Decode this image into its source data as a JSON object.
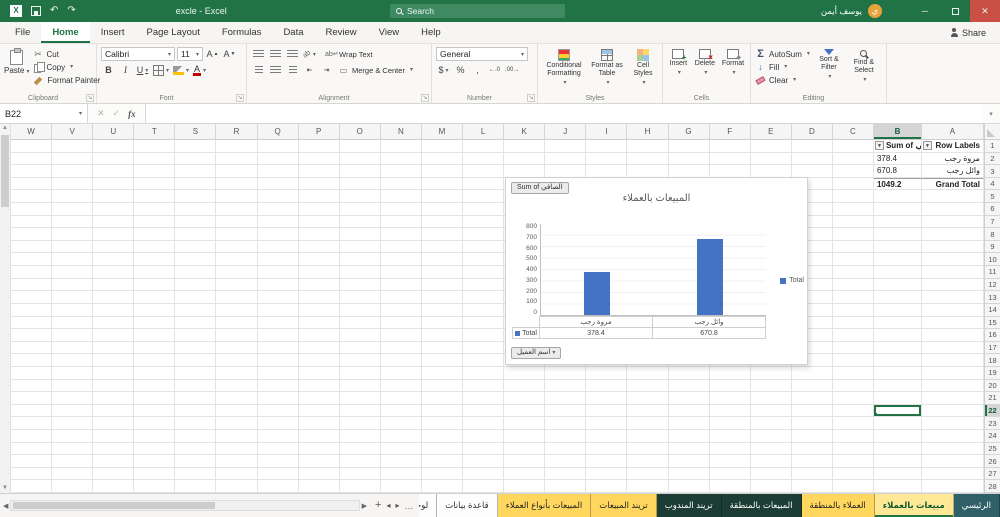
{
  "titlebar": {
    "app_title": "excle  -  Excel",
    "search_placeholder": "Search",
    "user_name": "يوسف أيمن",
    "user_initial": "ي"
  },
  "ribbon_tabs": {
    "items": [
      {
        "label": "File",
        "active": false
      },
      {
        "label": "Home",
        "active": true
      },
      {
        "label": "Insert",
        "active": false
      },
      {
        "label": "Page Layout",
        "active": false
      },
      {
        "label": "Formulas",
        "active": false
      },
      {
        "label": "Data",
        "active": false
      },
      {
        "label": "Review",
        "active": false
      },
      {
        "label": "View",
        "active": false
      },
      {
        "label": "Help",
        "active": false
      }
    ],
    "share_label": "Share"
  },
  "ribbon": {
    "clipboard": {
      "group": "Clipboard",
      "paste": "Paste",
      "cut": "Cut",
      "copy": "Copy",
      "format_painter": "Format Painter"
    },
    "font": {
      "group": "Font",
      "name": "Calibri",
      "size": "11",
      "bold": "B",
      "italic": "I",
      "underline": "U",
      "font_color_glyph": "A"
    },
    "alignment": {
      "group": "Alignment",
      "wrap": "Wrap Text",
      "merge": "Merge & Center"
    },
    "number": {
      "group": "Number",
      "format": "General",
      "currency": "$",
      "percent": "%",
      "comma": ",",
      "increase_decimal": "←.0",
      "decrease_decimal": ".00→"
    },
    "styles": {
      "group": "Styles",
      "conditional": "Conditional Formatting",
      "format_table": "Format as Table",
      "cell_styles": "Cell Styles"
    },
    "cells": {
      "group": "Cells",
      "insert": "Insert",
      "delete": "Delete",
      "format": "Format"
    },
    "editing": {
      "group": "Editing",
      "autosum_glyph": "Σ",
      "autosum": "AutoSum",
      "fill": "Fill",
      "clear": "Clear",
      "sort": "Sort & Filter",
      "find": "Find & Select"
    }
  },
  "formula_bar": {
    "name_box": "B22",
    "fx_label": "fx",
    "value": ""
  },
  "sheet": {
    "columns": [
      "W",
      "V",
      "U",
      "T",
      "S",
      "R",
      "Q",
      "P",
      "O",
      "N",
      "M",
      "L",
      "K",
      "J",
      "I",
      "H",
      "G",
      "F",
      "E",
      "D",
      "C",
      "B",
      "A"
    ],
    "row_count": 28,
    "selected_cell": {
      "col": "B",
      "row": 22
    },
    "pivot": {
      "col_a_header": "Row Labels",
      "col_b_header": "Sum of الصافي",
      "rows": [
        [
          "مروة رجب",
          "378.4"
        ],
        [
          "وائل رجب",
          "670.8"
        ]
      ],
      "grand_total_label": "Grand Total",
      "grand_total_value": "1049.2"
    }
  },
  "chart_data": {
    "type": "bar",
    "title": "المبيعات بالعملاء",
    "categories": [
      "مروة رجب",
      "وائل رجب"
    ],
    "series": [
      {
        "name": "Total",
        "values": [
          378.4,
          670.8
        ]
      }
    ],
    "value_labels": [
      "378.4",
      "670.8"
    ],
    "ylim": [
      0,
      800
    ],
    "yticks": [
      800,
      700,
      600,
      500,
      400,
      300,
      200,
      100,
      0
    ],
    "legend": "Total",
    "legend_position": "right",
    "grid": true,
    "pivot_field_button": "Sum of الصافي",
    "axis_field_button": "اسم العميل",
    "bar_color": "#4472c4"
  },
  "sheet_tabs": {
    "tabs": [
      {
        "label": "لوحة بيانات",
        "color": "light",
        "active": false,
        "partial": true
      },
      {
        "label": "قاعدة بيانات",
        "color": "light",
        "active": false
      },
      {
        "label": "المبيعات بأنواع العملاء",
        "color": "yellow",
        "active": false
      },
      {
        "label": "تريند المبيعات",
        "color": "yellow",
        "active": false
      },
      {
        "label": "تريند المندوب",
        "color": "dark",
        "active": false
      },
      {
        "label": "المبيعات بالمنطقة",
        "color": "dark",
        "active": false
      },
      {
        "label": "العملاء بالمنطقة",
        "color": "yellow",
        "active": false
      },
      {
        "label": "مبيعات بالعملاء",
        "color": "yellow",
        "active": true
      },
      {
        "label": "الرئيسي",
        "color": "teal",
        "active": false
      }
    ]
  },
  "colors": {
    "accent_green": "#217346",
    "bar_blue": "#4472c4",
    "tab_yellow": "#ffd75e",
    "tab_dark": "#1b3d34",
    "tab_teal": "#2f6069"
  }
}
